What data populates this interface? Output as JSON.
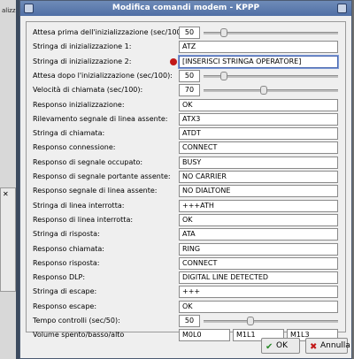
{
  "window": {
    "title": "Modifica comandi modem - KPPP"
  },
  "background": {
    "scrap_text": "alizza",
    "close_glyph": "✕"
  },
  "fields": [
    {
      "label": "Attesa prima dell'inizializzazione (sec/100):",
      "value": "50",
      "type": "slider",
      "level": 0.15
    },
    {
      "label": "Stringa di inizializzazione 1:",
      "value": "ATZ",
      "type": "text"
    },
    {
      "label": "Stringa di inizializzazione 2:",
      "value": "[INSERISCI STRINGA OPERATORE]",
      "type": "text",
      "focused": true
    },
    {
      "label": "Attesa dopo l'inizializzazione (sec/100):",
      "value": "50",
      "type": "slider",
      "level": 0.15
    },
    {
      "label": "Velocità di chiamata (sec/100):",
      "value": "70",
      "type": "slider",
      "level": 0.45
    },
    {
      "label": "Responso inizializzazione:",
      "value": "OK",
      "type": "text"
    },
    {
      "label": "Rilevamento segnale di linea assente:",
      "value": "ATX3",
      "type": "text"
    },
    {
      "label": "Stringa di chiamata:",
      "value": "ATDT",
      "type": "text"
    },
    {
      "label": "Responso connessione:",
      "value": "CONNECT",
      "type": "text"
    },
    {
      "label": "Responso di segnale occupato:",
      "value": "BUSY",
      "type": "text"
    },
    {
      "label": "Responso di segnale portante assente:",
      "value": "NO CARRIER",
      "type": "text"
    },
    {
      "label": "Responso segnale di linea assente:",
      "value": "NO DIALTONE",
      "type": "text"
    },
    {
      "label": "Stringa di linea interrotta:",
      "value": "+++ATH",
      "type": "text"
    },
    {
      "label": "Responso di linea interrotta:",
      "value": "OK",
      "type": "text"
    },
    {
      "label": "Stringa di risposta:",
      "value": "ATA",
      "type": "text"
    },
    {
      "label": "Responso chiamata:",
      "value": "RING",
      "type": "text"
    },
    {
      "label": "Responso risposta:",
      "value": "CONNECT",
      "type": "text"
    },
    {
      "label": "Responso DLP:",
      "value": "DIGITAL LINE DETECTED",
      "type": "text"
    },
    {
      "label": "Stringa di escape:",
      "value": "+++",
      "type": "text"
    },
    {
      "label": "Responso escape:",
      "value": "OK",
      "type": "text"
    },
    {
      "label": "Tempo controlli (sec/50):",
      "value": "50",
      "type": "slider",
      "level": 0.35
    }
  ],
  "volume": {
    "label": "Volume spento/basso/alto",
    "values": [
      "M0L0",
      "M1L1",
      "M1L3"
    ]
  },
  "buttons": {
    "ok": "OK",
    "cancel": "Annulla"
  },
  "colors": {
    "title_bar": "#4f6fa5",
    "required_dot": "#c21818"
  }
}
